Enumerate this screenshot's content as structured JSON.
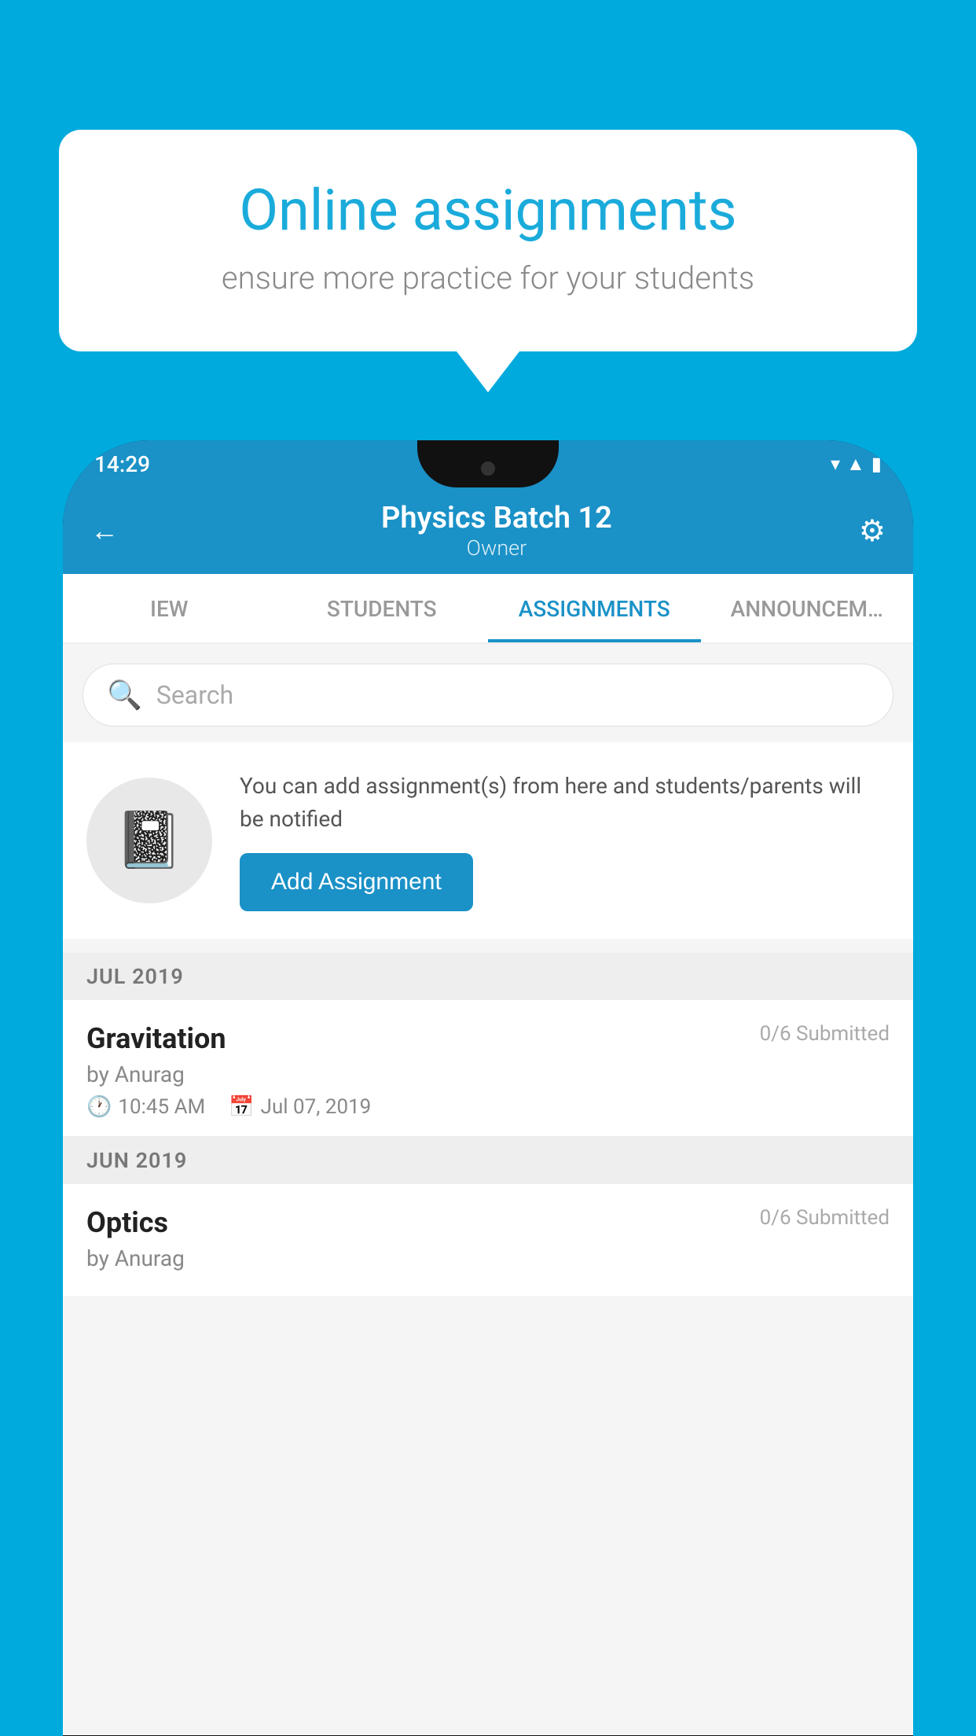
{
  "background_color": "#00AADD",
  "speech_bubble": {
    "title": "Online assignments",
    "subtitle": "ensure more practice for your students"
  },
  "phone": {
    "status_bar": {
      "time": "14:29"
    },
    "header": {
      "title": "Physics Batch 12",
      "subtitle": "Owner",
      "back_label": "←",
      "gear_label": "⚙"
    },
    "tabs": [
      {
        "label": "IEW",
        "active": false
      },
      {
        "label": "STUDENTS",
        "active": false
      },
      {
        "label": "ASSIGNMENTS",
        "active": true
      },
      {
        "label": "ANNOUNCEM…",
        "active": false
      }
    ],
    "search": {
      "placeholder": "Search"
    },
    "add_assignment_card": {
      "description": "You can add assignment(s) from here and students/parents will be notified",
      "button_label": "Add Assignment"
    },
    "sections": [
      {
        "month_label": "JUL 2019",
        "assignments": [
          {
            "name": "Gravitation",
            "submitted": "0/6 Submitted",
            "by": "by Anurag",
            "time": "10:45 AM",
            "date": "Jul 07, 2019"
          }
        ]
      },
      {
        "month_label": "JUN 2019",
        "assignments": [
          {
            "name": "Optics",
            "submitted": "0/6 Submitted",
            "by": "by Anurag",
            "time": "",
            "date": ""
          }
        ]
      }
    ]
  }
}
